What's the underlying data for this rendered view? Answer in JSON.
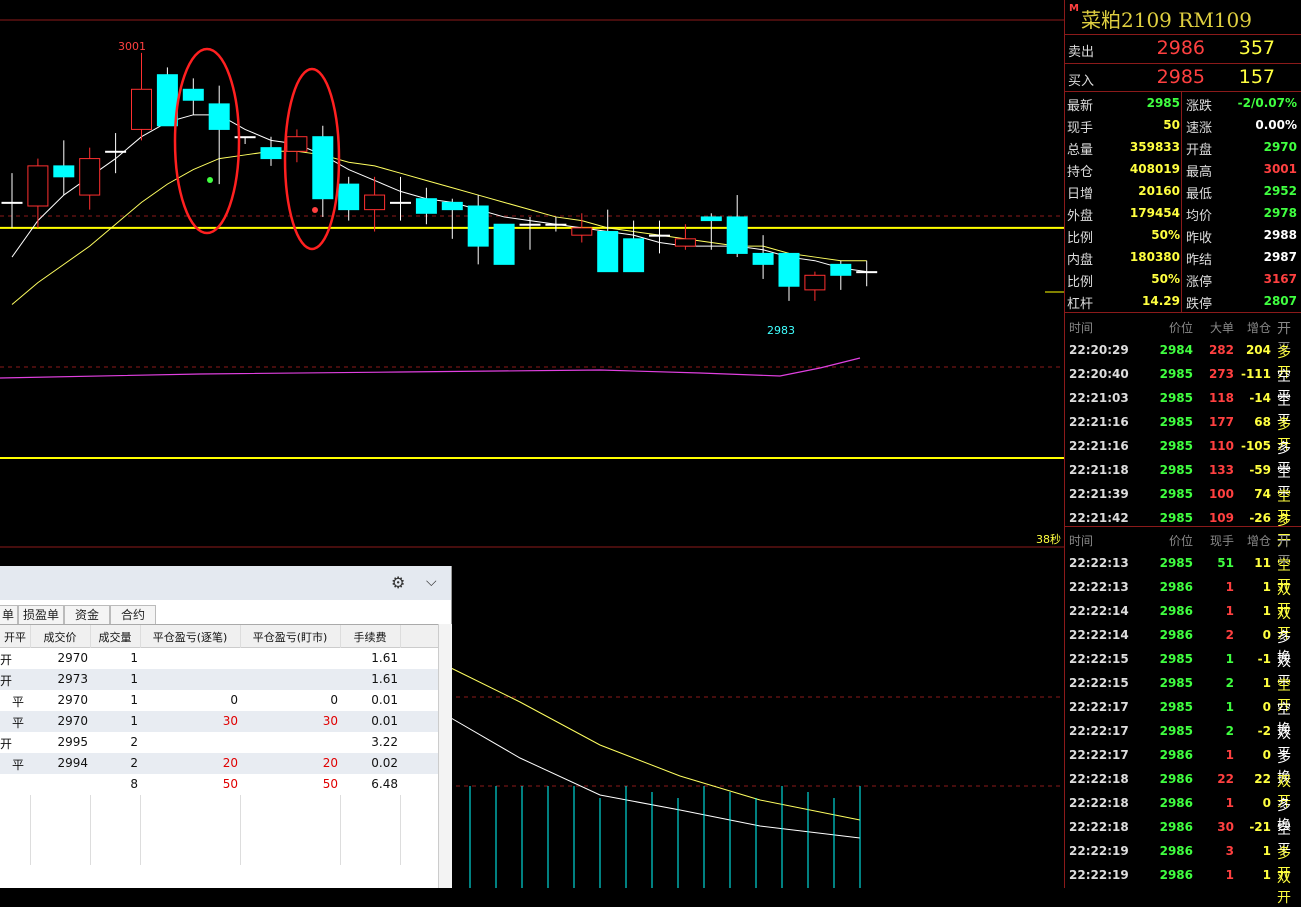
{
  "contract": {
    "m_badge": "M",
    "title": "菜粕2109  RM109"
  },
  "orderbook": [
    {
      "label": "卖出",
      "price": "2986",
      "volume": "357"
    },
    {
      "label": "买入",
      "price": "2985",
      "volume": "157"
    }
  ],
  "stats_left": [
    {
      "label": "最新",
      "value": "2985",
      "color": "#40ff40"
    },
    {
      "label": "现手",
      "value": "50",
      "color": "#ffff40"
    },
    {
      "label": "总量",
      "value": "359833",
      "color": "#ffff40"
    },
    {
      "label": "持仓",
      "value": "408019",
      "color": "#ffff40"
    },
    {
      "label": "日增",
      "value": "20160",
      "color": "#ffff40"
    },
    {
      "label": "外盘",
      "value": "179454",
      "color": "#ffff40"
    },
    {
      "label": "比例",
      "value": "50%",
      "color": "#ffff40"
    },
    {
      "label": "内盘",
      "value": "180380",
      "color": "#ffff40"
    },
    {
      "label": "比例",
      "value": "50%",
      "color": "#ffff40"
    },
    {
      "label": "杠杆",
      "value": "14.29",
      "color": "#ffff40"
    }
  ],
  "stats_right": [
    {
      "label": "涨跌",
      "value": "-2/0.07%",
      "color": "#40ff40"
    },
    {
      "label": "速涨",
      "value": "0.00%",
      "color": "#ffffff"
    },
    {
      "label": "开盘",
      "value": "2970",
      "color": "#40ff40"
    },
    {
      "label": "最高",
      "value": "3001",
      "color": "#ff4040"
    },
    {
      "label": "最低",
      "value": "2952",
      "color": "#40ff40"
    },
    {
      "label": "均价",
      "value": "2978",
      "color": "#40ff40"
    },
    {
      "label": "昨收",
      "value": "2988",
      "color": "#ffffff"
    },
    {
      "label": "昨结",
      "value": "2987",
      "color": "#ffffff"
    },
    {
      "label": "涨停",
      "value": "3167",
      "color": "#ff4040"
    },
    {
      "label": "跌停",
      "value": "2807",
      "color": "#40ff40"
    }
  ],
  "ticks1_header": {
    "time": "时间",
    "price": "价位",
    "vol": "大单",
    "oi": "增仓",
    "kind": "开平"
  },
  "ticks1": [
    {
      "time": "22:20:29",
      "price": "2984",
      "vol": "282",
      "oi": "204",
      "kind": "多开"
    },
    {
      "time": "22:20:40",
      "price": "2985",
      "vol": "273",
      "oi": "-111",
      "kind": "空平"
    },
    {
      "time": "22:21:03",
      "price": "2985",
      "vol": "118",
      "oi": "-14",
      "kind": "空平"
    },
    {
      "time": "22:21:16",
      "price": "2985",
      "vol": "177",
      "oi": "68",
      "kind": "多开"
    },
    {
      "time": "22:21:16",
      "price": "2985",
      "vol": "110",
      "oi": "-105",
      "kind": "多平"
    },
    {
      "time": "22:21:18",
      "price": "2985",
      "vol": "133",
      "oi": "-59",
      "kind": "空平"
    },
    {
      "time": "22:21:39",
      "price": "2985",
      "vol": "100",
      "oi": "74",
      "kind": "空开"
    },
    {
      "time": "22:21:42",
      "price": "2985",
      "vol": "109",
      "oi": "-26",
      "kind": "多开"
    }
  ],
  "ticks2_header": {
    "time": "时间",
    "price": "价位",
    "vol": "现手",
    "oi": "增仓",
    "kind": "开平"
  },
  "ticks2": [
    {
      "time": "22:22:13",
      "price": "2985",
      "vol": "51",
      "oi": "11",
      "kind": "空开",
      "pc": "#40ff40",
      "vc": "#40ff40"
    },
    {
      "time": "22:22:13",
      "price": "2986",
      "vol": "1",
      "oi": "1",
      "kind": "双开",
      "pc": "#40ff40",
      "vc": "#ff4040"
    },
    {
      "time": "22:22:14",
      "price": "2986",
      "vol": "1",
      "oi": "1",
      "kind": "双开",
      "pc": "#40ff40",
      "vc": "#ff4040"
    },
    {
      "time": "22:22:14",
      "price": "2986",
      "vol": "2",
      "oi": "0",
      "kind": "多换",
      "pc": "#40ff40",
      "vc": "#ff4040"
    },
    {
      "time": "22:22:15",
      "price": "2985",
      "vol": "1",
      "oi": "-1",
      "kind": "双平",
      "pc": "#40ff40",
      "vc": "#40ff40"
    },
    {
      "time": "22:22:15",
      "price": "2985",
      "vol": "2",
      "oi": "1",
      "kind": "空开",
      "pc": "#40ff40",
      "vc": "#40ff40"
    },
    {
      "time": "22:22:17",
      "price": "2985",
      "vol": "1",
      "oi": "0",
      "kind": "空换",
      "pc": "#40ff40",
      "vc": "#40ff40"
    },
    {
      "time": "22:22:17",
      "price": "2985",
      "vol": "2",
      "oi": "-2",
      "kind": "双平",
      "pc": "#40ff40",
      "vc": "#40ff40"
    },
    {
      "time": "22:22:17",
      "price": "2986",
      "vol": "1",
      "oi": "0",
      "kind": "多换",
      "pc": "#40ff40",
      "vc": "#ff4040"
    },
    {
      "time": "22:22:18",
      "price": "2986",
      "vol": "22",
      "oi": "22",
      "kind": "双开",
      "pc": "#40ff40",
      "vc": "#ff4040"
    },
    {
      "time": "22:22:18",
      "price": "2986",
      "vol": "1",
      "oi": "0",
      "kind": "多换",
      "pc": "#40ff40",
      "vc": "#ff4040"
    },
    {
      "time": "22:22:18",
      "price": "2986",
      "vol": "30",
      "oi": "-21",
      "kind": "空平",
      "pc": "#40ff40",
      "vc": "#ff4040"
    },
    {
      "time": "22:22:19",
      "price": "2986",
      "vol": "3",
      "oi": "1",
      "kind": "多开",
      "pc": "#40ff40",
      "vc": "#ff4040"
    },
    {
      "time": "22:22:19",
      "price": "2986",
      "vol": "1",
      "oi": "1",
      "kind": "双开",
      "pc": "#40ff40",
      "vc": "#ff4040"
    }
  ],
  "chart": {
    "high_label": "3001",
    "low_label": "2983",
    "countdown": "38秒",
    "colors": {
      "up": "#ff3030",
      "down": "#00ffff",
      "ma_fast": "#ffffff",
      "ma_slow": "#ffff60",
      "level": "#ffff00",
      "magenta": "#e040e0",
      "highlight": "#ff2020"
    }
  },
  "chart_data": {
    "type": "candlestick",
    "candles": [
      {
        "o": 2960,
        "h": 2968,
        "l": 2953,
        "c": 2960
      },
      {
        "o": 2959,
        "h": 2972,
        "l": 2953,
        "c": 2970
      },
      {
        "o": 2970,
        "h": 2977,
        "l": 2962,
        "c": 2967
      },
      {
        "o": 2962,
        "h": 2975,
        "l": 2958,
        "c": 2972
      },
      {
        "o": 2974,
        "h": 2979,
        "l": 2968,
        "c": 2974
      },
      {
        "o": 2980,
        "h": 3001,
        "l": 2977,
        "c": 2991
      },
      {
        "o": 2995,
        "h": 2997,
        "l": 2981,
        "c": 2981
      },
      {
        "o": 2991,
        "h": 2994,
        "l": 2984,
        "c": 2988
      },
      {
        "o": 2987,
        "h": 2992,
        "l": 2965,
        "c": 2980
      },
      {
        "o": 2978,
        "h": 2978,
        "l": 2976,
        "c": 2978
      },
      {
        "o": 2975,
        "h": 2978,
        "l": 2970,
        "c": 2972
      },
      {
        "o": 2974,
        "h": 2980,
        "l": 2971,
        "c": 2978
      },
      {
        "o": 2978,
        "h": 2981,
        "l": 2956,
        "c": 2961
      },
      {
        "o": 2965,
        "h": 2967,
        "l": 2955,
        "c": 2958
      },
      {
        "o": 2958,
        "h": 2967,
        "l": 2952,
        "c": 2962
      },
      {
        "o": 2960,
        "h": 2967,
        "l": 2955,
        "c": 2960
      },
      {
        "o": 2961,
        "h": 2964,
        "l": 2954,
        "c": 2957
      },
      {
        "o": 2960,
        "h": 2961,
        "l": 2950,
        "c": 2958
      },
      {
        "o": 2959,
        "h": 2962,
        "l": 2943,
        "c": 2948
      },
      {
        "o": 2954,
        "h": 2954,
        "l": 2943,
        "c": 2943
      },
      {
        "o": 2954,
        "h": 2956,
        "l": 2947,
        "c": 2954
      },
      {
        "o": 2954,
        "h": 2956,
        "l": 2952,
        "c": 2954
      },
      {
        "o": 2951,
        "h": 2957,
        "l": 2949,
        "c": 2953
      },
      {
        "o": 2952,
        "h": 2958,
        "l": 2945,
        "c": 2941
      },
      {
        "o": 2950,
        "h": 2955,
        "l": 2941,
        "c": 2941
      },
      {
        "o": 2951,
        "h": 2955,
        "l": 2946,
        "c": 2951
      },
      {
        "o": 2948,
        "h": 2954,
        "l": 2947,
        "c": 2950
      },
      {
        "o": 2956,
        "h": 2957,
        "l": 2947,
        "c": 2955
      },
      {
        "o": 2956,
        "h": 2962,
        "l": 2945,
        "c": 2946
      },
      {
        "o": 2946,
        "h": 2951,
        "l": 2939,
        "c": 2943
      },
      {
        "o": 2946,
        "h": 2946,
        "l": 2933,
        "c": 2937
      },
      {
        "o": 2936,
        "h": 2941,
        "l": 2933,
        "c": 2940
      },
      {
        "o": 2943,
        "h": 2944,
        "l": 2936,
        "c": 2940
      },
      {
        "o": 2941,
        "h": 2944,
        "l": 2937,
        "c": 2941
      }
    ],
    "ma_fast": [
      2945,
      2955,
      2962,
      2967,
      2972,
      2978,
      2982,
      2984,
      2984,
      2980,
      2977,
      2976,
      2973,
      2969,
      2966,
      2963,
      2961,
      2960,
      2958,
      2956,
      2955,
      2954,
      2953,
      2952,
      2951,
      2949,
      2948,
      2948,
      2948,
      2947,
      2945,
      2944,
      2942,
      2941
    ],
    "ma_slow": [
      2932,
      2938,
      2943,
      2948,
      2954,
      2960,
      2965,
      2969,
      2972,
      2973,
      2974,
      2974,
      2973,
      2971,
      2970,
      2968,
      2966,
      2964,
      2962,
      2960,
      2958,
      2956,
      2955,
      2953,
      2952,
      2951,
      2950,
      2949,
      2948,
      2948,
      2946,
      2945,
      2944,
      2944
    ],
    "horizontal_level": 2953,
    "price_min": 2925,
    "price_max": 3010
  },
  "trade_window": {
    "tabs": [
      "单",
      "损盈单",
      "资金",
      "合约"
    ],
    "headers": [
      "开平",
      "成交价",
      "成交量",
      "平仓盈亏(逐笔)",
      "平仓盈亏(盯市)",
      "手续费"
    ],
    "rows": [
      {
        "kp": "开",
        "price": "2970",
        "qty": "1",
        "pl1": "",
        "pl2": "",
        "fee": "1.61"
      },
      {
        "kp": "开",
        "price": "2973",
        "qty": "1",
        "pl1": "",
        "pl2": "",
        "fee": "1.61"
      },
      {
        "kp": "平",
        "price": "2970",
        "qty": "1",
        "pl1": "0",
        "pl2": "0",
        "fee": "0.01"
      },
      {
        "kp": "平",
        "price": "2970",
        "qty": "1",
        "pl1": "30",
        "pl2": "30",
        "fee": "0.01"
      },
      {
        "kp": "开",
        "price": "2995",
        "qty": "2",
        "pl1": "",
        "pl2": "",
        "fee": "3.22"
      },
      {
        "kp": "平",
        "price": "2994",
        "qty": "2",
        "pl1": "20",
        "pl2": "20",
        "fee": "0.02"
      },
      {
        "kp": "",
        "price": "",
        "qty": "8",
        "pl1": "50",
        "pl2": "50",
        "fee": "6.48"
      }
    ]
  }
}
